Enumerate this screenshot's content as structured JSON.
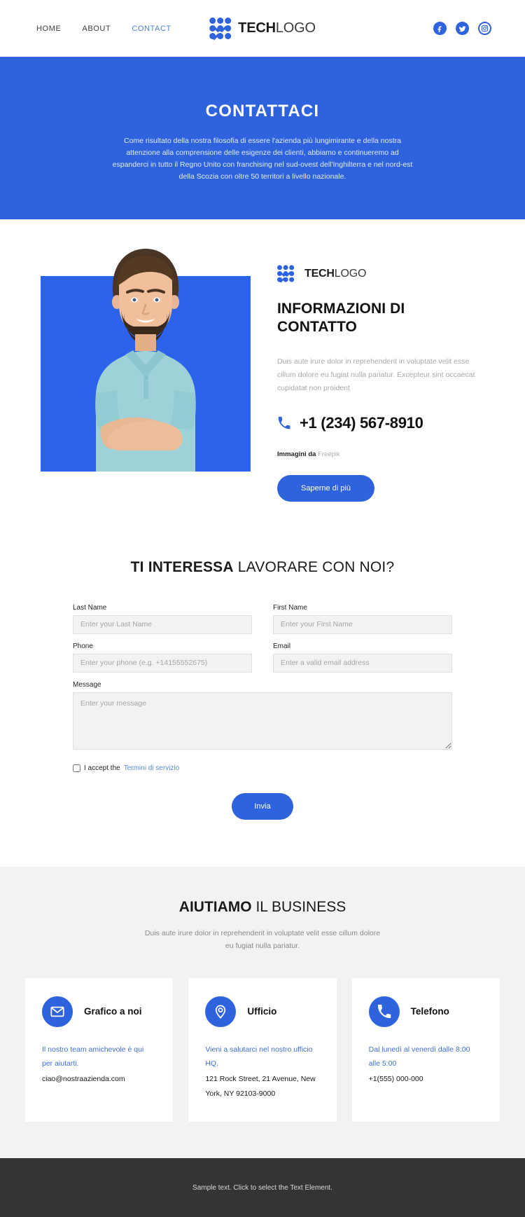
{
  "header": {
    "nav": [
      {
        "label": "HOME",
        "active": false
      },
      {
        "label": "ABOUT",
        "active": false
      },
      {
        "label": "CONTACT",
        "active": true
      }
    ],
    "brand": {
      "bold": "TECH",
      "light": "LOGO"
    },
    "socials": [
      {
        "name": "facebook",
        "glyph": "f"
      },
      {
        "name": "twitter",
        "glyph": "t"
      },
      {
        "name": "instagram",
        "glyph": "i"
      }
    ]
  },
  "hero": {
    "title": "CONTATTACI",
    "paragraph": "Come risultato della nostra filosofia di essere l'azienda più lungimirante e della nostra attenzione alla comprensione delle esigenze dei clienti, abbiamo e continueremo ad espanderci in tutto il Regno Unito con franchising nel sud-ovest dell'Inghilterra e nel nord-est della Scozia con oltre 50 territori a livello nazionale."
  },
  "info": {
    "brand": {
      "bold": "TECH",
      "light": "LOGO"
    },
    "title": "INFORMAZIONI DI CONTATTO",
    "description": "Duis aute irure dolor in reprehenderit in voluptate velit esse cillum dolore eu fugiat nulla pariatur. Excepteur sint occaecat cupidatat non proident",
    "phone": "+1 (234) 567-8910",
    "credit_prefix": "Immagini da",
    "credit_source": "Freepik",
    "cta_label": "Saperne di più"
  },
  "form": {
    "heading_bold": "TI INTERESSA",
    "heading_light": " LAVORARE CON NOI?",
    "fields": [
      {
        "label": "Last Name",
        "placeholder": "Enter your Last Name",
        "value": ""
      },
      {
        "label": "First Name",
        "placeholder": "Enter your First Name",
        "value": ""
      },
      {
        "label": "Phone",
        "placeholder": "Enter your phone (e.g. +14155552675)",
        "value": ""
      },
      {
        "label": "Email",
        "placeholder": "Enter a valid email address",
        "value": ""
      },
      {
        "label": "Message",
        "placeholder": "Enter your message",
        "value": ""
      }
    ],
    "accept_prefix": "I accept the",
    "accept_link": "Termini di servizio",
    "submit_label": "Invia"
  },
  "help": {
    "heading_bold": "AIUTIAMO",
    "heading_light": " IL BUSINESS",
    "subtitle": "Duis aute irure dolor in reprehenderit in voluptate velit esse cillum dolore eu fugiat nulla pariatur.",
    "cards": [
      {
        "icon": "envelope-icon",
        "title": "Grafico a noi",
        "note": "Il nostro team amichevole è qui per aiutarti.",
        "value": "ciao@nostraazienda.com"
      },
      {
        "icon": "location-pin-icon",
        "title": "Ufficio",
        "note": "Vieni a salutarci nel nostro ufficio HQ.",
        "value": "121 Rock Street, 21 Avenue, New York, NY 92103-9000"
      },
      {
        "icon": "phone-icon",
        "title": "Telefono",
        "note": "Dal lunedì al venerdì dalle 8:00 alle 5:00",
        "value": "+1(555) 000-000"
      }
    ]
  },
  "footer": {
    "text": "Sample text. Click to select the Text Element."
  },
  "colors": {
    "brand_blue": "#2f62dd",
    "hero_blue": "#2f62dd",
    "photo_blue": "#2d62ea",
    "gray_section": "#f2f2f2",
    "footer_dark": "#343434",
    "link_blue": "#5a8ad6"
  }
}
